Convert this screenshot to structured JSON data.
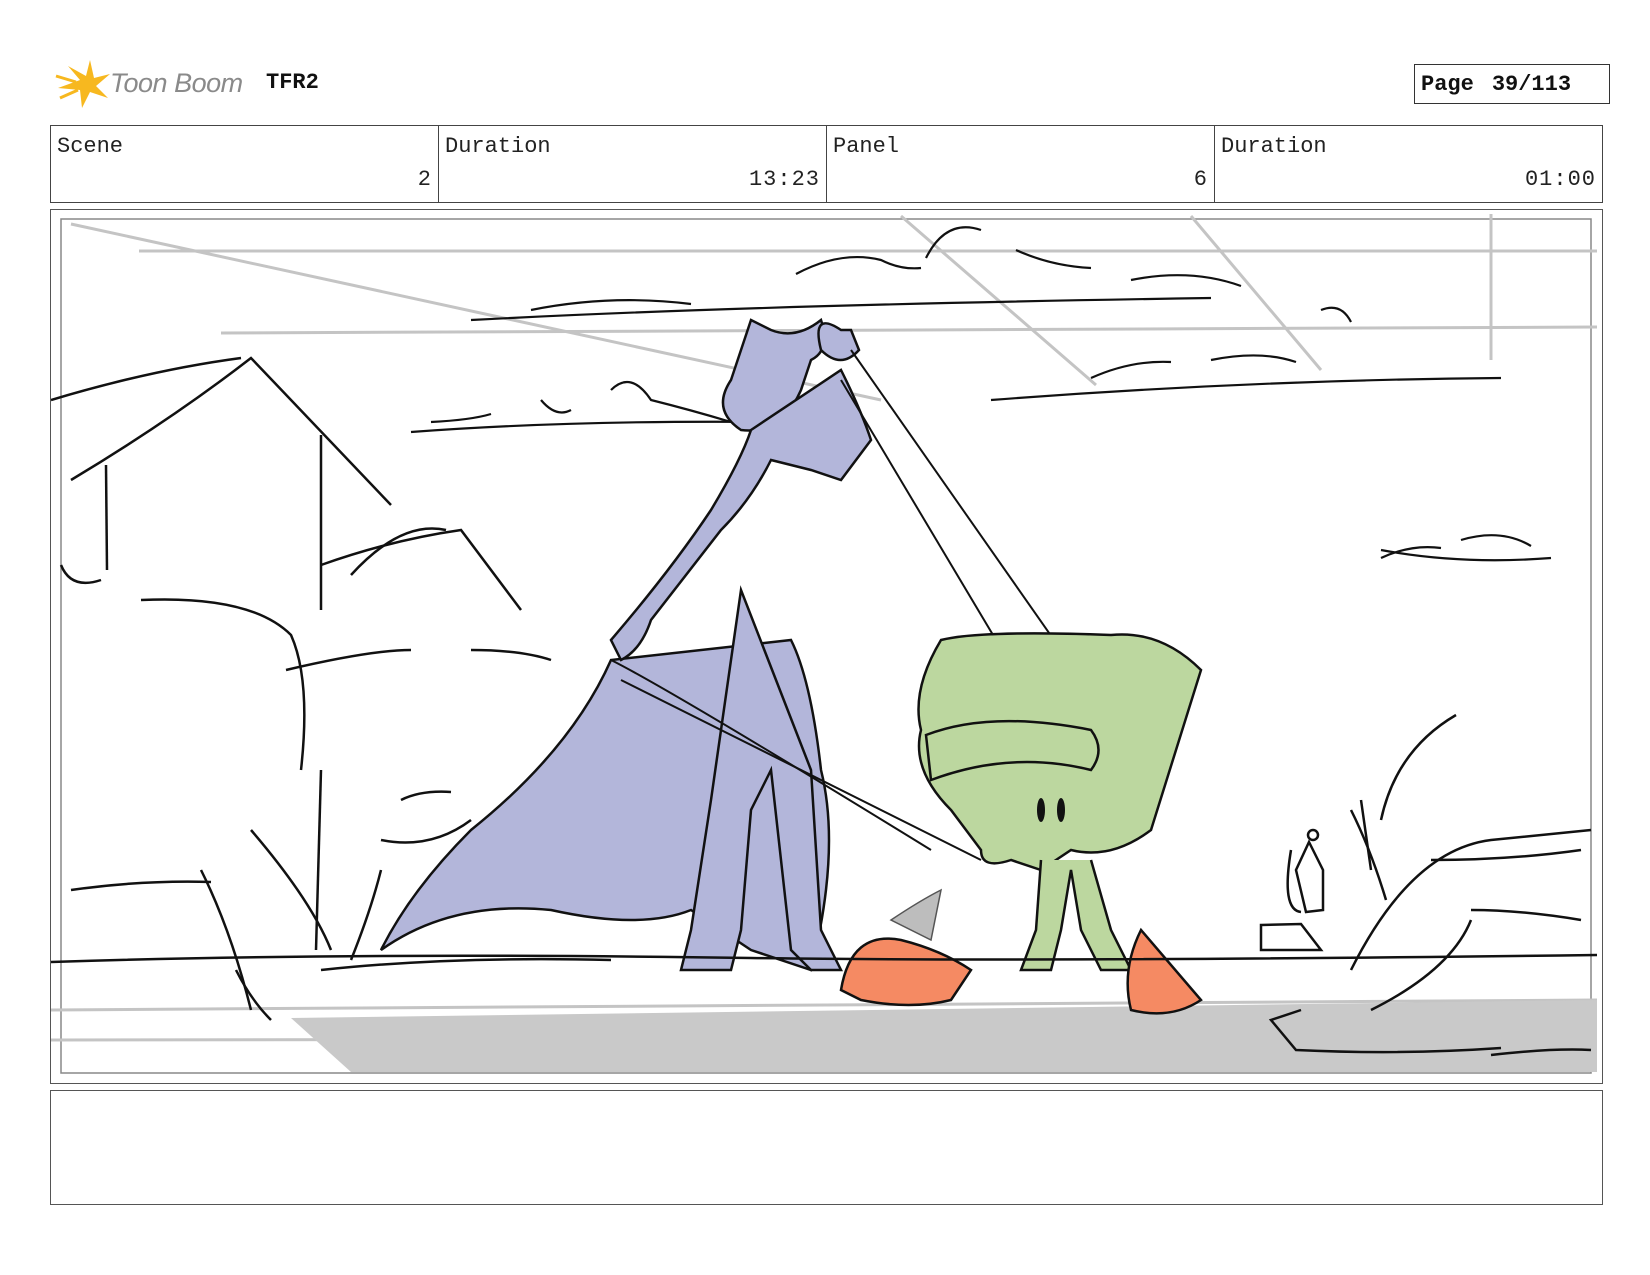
{
  "header": {
    "logo_text": "Toon Boom",
    "project": "TFR2",
    "page_label": "Page",
    "page_value": "39/113"
  },
  "info": {
    "scene_label": "Scene",
    "scene_value": "2",
    "scene_duration_label": "Duration",
    "scene_duration_value": "13:23",
    "panel_label": "Panel",
    "panel_value": "6",
    "panel_duration_label": "Duration",
    "panel_duration_value": "01:00"
  },
  "notes": {
    "text": ""
  },
  "colors": {
    "cat_fill": "#b3b6da",
    "hat_fill": "#bcd79f",
    "rock_fill": "#f58a63",
    "ground_fill": "#c9c9c9",
    "logo_star": "#f7b81f"
  }
}
